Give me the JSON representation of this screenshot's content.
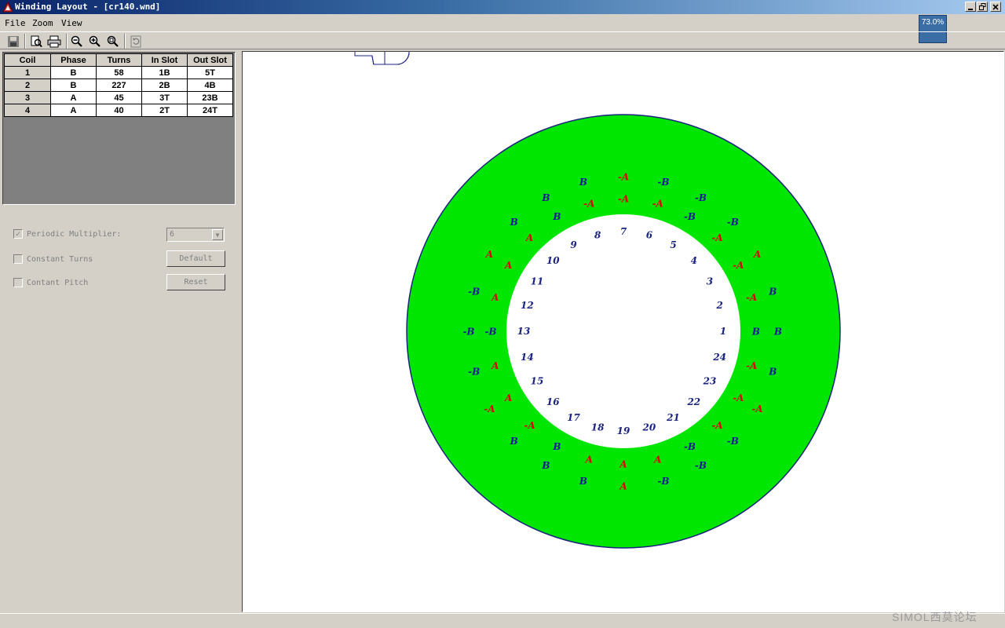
{
  "window": {
    "title": "Winding Layout - [cr140.wnd]"
  },
  "menu": [
    "File",
    "Zoom",
    "View"
  ],
  "zoom_indicator": "73.0%",
  "toolbar": {
    "buttons": [
      "save-icon",
      "print-preview-icon",
      "print-icon",
      "zoom-out-icon",
      "zoom-in-icon",
      "zoom-fit-icon",
      "refresh-icon"
    ]
  },
  "coil_table": {
    "headers": [
      "Coil",
      "Phase",
      "Turns",
      "In Slot",
      "Out Slot"
    ],
    "rows": [
      [
        "1",
        "B",
        "58",
        "1B",
        "5T"
      ],
      [
        "2",
        "B",
        "227",
        "2B",
        "4B"
      ],
      [
        "3",
        "A",
        "45",
        "3T",
        "23B"
      ],
      [
        "4",
        "A",
        "40",
        "2T",
        "24T"
      ]
    ]
  },
  "options": {
    "periodic_multiplier": {
      "label": "Periodic Multiplier:",
      "checked": true,
      "value": "6"
    },
    "constant_turns": {
      "label": "Constant Turns",
      "checked": false
    },
    "constant_pitch": {
      "label": "Contant Pitch",
      "checked": false
    },
    "default_button": "Default",
    "reset_button": "Reset"
  },
  "stator": {
    "colors": {
      "core": "#00e600",
      "outline": "#1a237e",
      "phase_a": "#e00000",
      "phase_b": "#1a1a99",
      "slot_fill": "#ffffff"
    },
    "slot_numbers": [
      "1",
      "2",
      "3",
      "4",
      "5",
      "6",
      "7",
      "8",
      "9",
      "10",
      "11",
      "12",
      "13",
      "14",
      "15",
      "16",
      "17",
      "18",
      "19",
      "20",
      "21",
      "22",
      "23",
      "24"
    ],
    "slots": [
      {
        "outer": "B",
        "inner": "B"
      },
      {
        "outer": "B",
        "inner": "-A"
      },
      {
        "outer": "A",
        "inner": "-A"
      },
      {
        "outer": "-B",
        "inner": "-A"
      },
      {
        "outer": "-B",
        "inner": "-B"
      },
      {
        "outer": "-B",
        "inner": "-A"
      },
      {
        "outer": "-A",
        "inner": "-A"
      },
      {
        "outer": "B",
        "inner": "-A"
      },
      {
        "outer": "B",
        "inner": "B"
      },
      {
        "outer": "B",
        "inner": "A"
      },
      {
        "outer": "A",
        "inner": "A"
      },
      {
        "outer": "-B",
        "inner": "A"
      },
      {
        "outer": "-B",
        "inner": "-B"
      },
      {
        "outer": "-B",
        "inner": "A"
      },
      {
        "outer": "-A",
        "inner": "A"
      },
      {
        "outer": "B",
        "inner": "-A"
      },
      {
        "outer": "B",
        "inner": "B"
      },
      {
        "outer": "B",
        "inner": "A"
      },
      {
        "outer": "A",
        "inner": "A"
      },
      {
        "outer": "-B",
        "inner": "A"
      },
      {
        "outer": "-B",
        "inner": "-B"
      },
      {
        "outer": "-B",
        "inner": "-A"
      },
      {
        "outer": "-A",
        "inner": "-A"
      },
      {
        "outer": "B",
        "inner": "-A"
      }
    ]
  },
  "watermark": "SIMOL西莫论坛"
}
